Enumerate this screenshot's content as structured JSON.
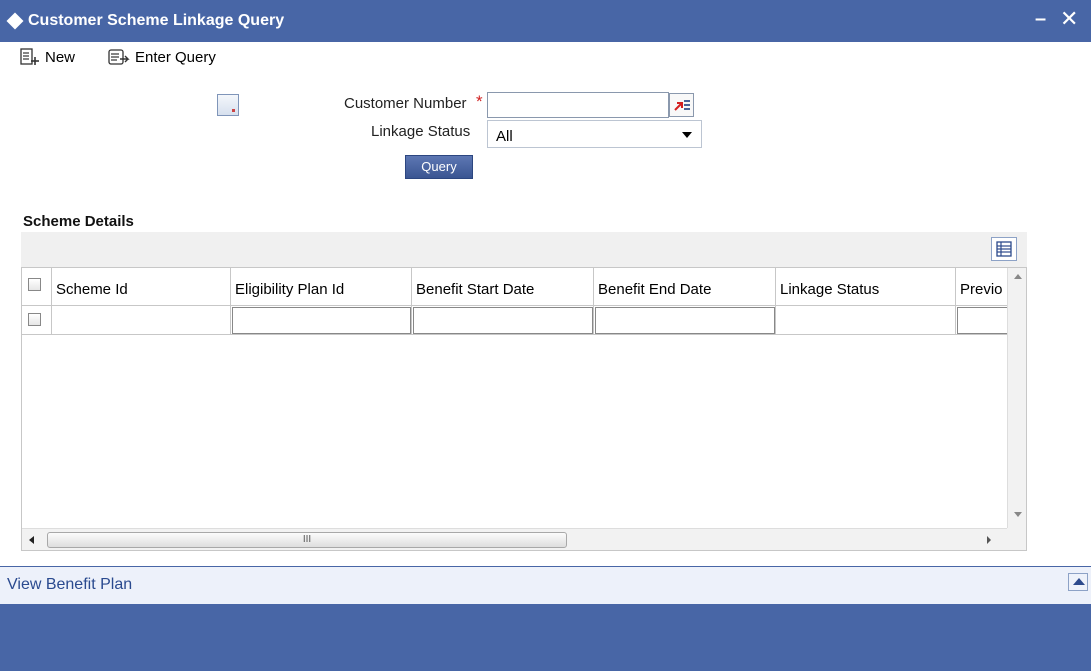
{
  "window": {
    "title": "Customer Scheme Linkage Query",
    "minimize_glyph": "–",
    "close_glyph": "✕"
  },
  "toolbar": {
    "new_label": "New",
    "new_icon": "new-document-icon",
    "enter_query_label": "Enter Query",
    "enter_query_icon": "enter-query-icon"
  },
  "form": {
    "customer_number_label": "Customer Number",
    "required_mark": "*",
    "customer_number_value": "",
    "linkage_status_label": "Linkage Status",
    "linkage_status_value": "All",
    "query_button": "Query"
  },
  "scheme_details": {
    "title": "Scheme Details",
    "columns": [
      "Scheme Id",
      "Eligibility Plan Id",
      "Benefit Start Date",
      "Benefit End Date",
      "Linkage Status",
      "Previo"
    ],
    "rows": [
      [
        "",
        "",
        "",
        "",
        "",
        ""
      ]
    ],
    "scroll_thumb_grip": "III"
  },
  "footer": {
    "view_benefit_plan": "View Benefit Plan"
  },
  "colors": {
    "title_bar": "#4866a6",
    "required": "#d02020",
    "link": "#2a4a8f"
  }
}
